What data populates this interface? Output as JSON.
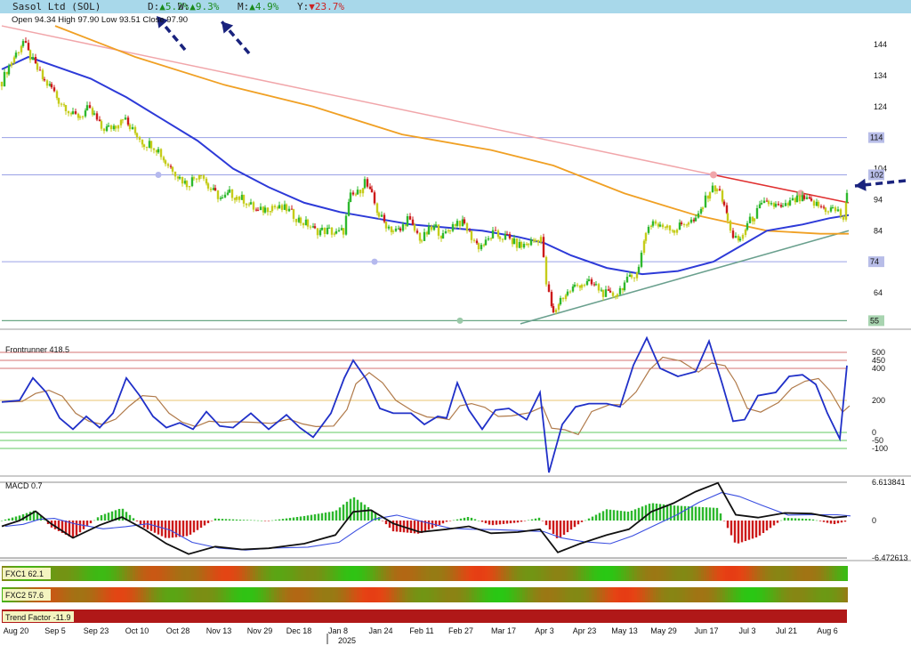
{
  "header": {
    "title": "Sasol Ltd (SOL)",
    "day": {
      "label": "D:",
      "arrow": "▲",
      "value": "5.2%",
      "color": "#1a8a1a"
    },
    "week": {
      "label": "W:",
      "arrow": "▲",
      "value": "9.3%",
      "color": "#1a8a1a"
    },
    "month": {
      "label": "M:",
      "arrow": "▲",
      "value": "4.9%",
      "color": "#1a8a1a"
    },
    "year": {
      "label": "Y:",
      "arrow": "▼",
      "value": "23.7%",
      "color": "#cc2222"
    }
  },
  "ohlc": "Open 94.34  High 97.90  Low 93.51  Close 97.90",
  "panels": {
    "frontrunner_label": "Frontrunner 418.5",
    "macd_label": "MACD 0.7",
    "fxc1_label": "FXC1 62.1",
    "fxc2_label": "FXC2 57.6",
    "trend_label": "Trend Factor -11.9"
  },
  "year_label": "2025",
  "chart_data": [
    {
      "type": "candlestick",
      "title": "Sasol Ltd (SOL)",
      "y_ticks": [
        144,
        134,
        124,
        104,
        94,
        84,
        64
      ],
      "ylim": [
        52,
        152
      ],
      "x_ticks": [
        "Aug 20",
        "Sep 5",
        "Sep 23",
        "Oct 10",
        "Oct 28",
        "Nov 13",
        "Nov 29",
        "Dec 18",
        "Jan 8",
        "Jan 24",
        "Feb 11",
        "Feb 27",
        "Mar 17",
        "Apr 3",
        "Apr 23",
        "May 13",
        "May 29",
        "Jun 17",
        "Jul 3",
        "Jul 21",
        "Aug 6"
      ],
      "price_tags": [
        {
          "value": "114",
          "price": 114,
          "bg": "#b8bde8"
        },
        {
          "value": "102",
          "price": 102,
          "bg": "#b8bde8"
        },
        {
          "value": "74",
          "price": 74,
          "bg": "#b8bde8"
        },
        {
          "value": "55",
          "price": 55,
          "bg": "#a8d4b0"
        }
      ],
      "close_path": [
        [
          0,
          132
        ],
        [
          8,
          137
        ],
        [
          16,
          141
        ],
        [
          24,
          145
        ],
        [
          32,
          140
        ],
        [
          40,
          136
        ],
        [
          48,
          132
        ],
        [
          56,
          130
        ],
        [
          64,
          126
        ],
        [
          72,
          124
        ],
        [
          80,
          121
        ],
        [
          88,
          121
        ],
        [
          96,
          123
        ],
        [
          104,
          121
        ],
        [
          112,
          117
        ],
        [
          120,
          117
        ],
        [
          128,
          118
        ],
        [
          136,
          121
        ],
        [
          144,
          117
        ],
        [
          152,
          115
        ],
        [
          160,
          112
        ],
        [
          168,
          112
        ],
        [
          176,
          110
        ],
        [
          184,
          106
        ],
        [
          192,
          104
        ],
        [
          200,
          101
        ],
        [
          208,
          99
        ],
        [
          216,
          101
        ],
        [
          224,
          103
        ],
        [
          232,
          98
        ],
        [
          240,
          96
        ],
        [
          248,
          94
        ],
        [
          256,
          96
        ],
        [
          264,
          95
        ],
        [
          272,
          94
        ],
        [
          280,
          92
        ],
        [
          288,
          90
        ],
        [
          296,
          91
        ],
        [
          304,
          92
        ],
        [
          312,
          91
        ],
        [
          320,
          91
        ],
        [
          328,
          89
        ],
        [
          336,
          87
        ],
        [
          344,
          86
        ],
        [
          352,
          84
        ],
        [
          360,
          84
        ],
        [
          368,
          84
        ],
        [
          376,
          83
        ],
        [
          384,
          84
        ],
        [
          392,
          95
        ],
        [
          400,
          96
        ],
        [
          408,
          100
        ],
        [
          416,
          95
        ],
        [
          424,
          89
        ],
        [
          432,
          86
        ],
        [
          440,
          84
        ],
        [
          448,
          84
        ],
        [
          456,
          88
        ],
        [
          464,
          84
        ],
        [
          472,
          81
        ],
        [
          480,
          84
        ],
        [
          488,
          85
        ],
        [
          496,
          82
        ],
        [
          504,
          85
        ],
        [
          512,
          87
        ],
        [
          520,
          86
        ],
        [
          528,
          82
        ],
        [
          536,
          79
        ],
        [
          544,
          80
        ],
        [
          552,
          83
        ],
        [
          560,
          82
        ],
        [
          568,
          82
        ],
        [
          576,
          80
        ],
        [
          584,
          79
        ],
        [
          592,
          80
        ],
        [
          600,
          81
        ],
        [
          606,
          82
        ],
        [
          612,
          67
        ],
        [
          620,
          57
        ],
        [
          628,
          62
        ],
        [
          636,
          64
        ],
        [
          644,
          66
        ],
        [
          652,
          67
        ],
        [
          660,
          67
        ],
        [
          668,
          66
        ],
        [
          676,
          64
        ],
        [
          684,
          63
        ],
        [
          692,
          64
        ],
        [
          700,
          67
        ],
        [
          708,
          69
        ],
        [
          716,
          72
        ],
        [
          724,
          84
        ],
        [
          732,
          87
        ],
        [
          740,
          85
        ],
        [
          748,
          86
        ],
        [
          756,
          84
        ],
        [
          764,
          86
        ],
        [
          772,
          87
        ],
        [
          780,
          87
        ],
        [
          788,
          92
        ],
        [
          796,
          97
        ],
        [
          804,
          98
        ],
        [
          812,
          92
        ],
        [
          816,
          88
        ],
        [
          822,
          81
        ],
        [
          830,
          81
        ],
        [
          838,
          86
        ],
        [
          846,
          89
        ],
        [
          854,
          92
        ],
        [
          862,
          93
        ],
        [
          870,
          92
        ],
        [
          878,
          91
        ],
        [
          886,
          93
        ],
        [
          894,
          94
        ],
        [
          902,
          94
        ],
        [
          910,
          93
        ],
        [
          918,
          92
        ],
        [
          926,
          91
        ],
        [
          934,
          91
        ],
        [
          940,
          90
        ],
        [
          946,
          88
        ],
        [
          950,
          95
        ]
      ],
      "ma_blue": [
        [
          0,
          136
        ],
        [
          30,
          140
        ],
        [
          60,
          137
        ],
        [
          100,
          133
        ],
        [
          140,
          127
        ],
        [
          180,
          120
        ],
        [
          220,
          113
        ],
        [
          260,
          104
        ],
        [
          300,
          98
        ],
        [
          340,
          93
        ],
        [
          380,
          90
        ],
        [
          420,
          88
        ],
        [
          460,
          86
        ],
        [
          500,
          85
        ],
        [
          540,
          84
        ],
        [
          580,
          82
        ],
        [
          610,
          80
        ],
        [
          640,
          76
        ],
        [
          680,
          72
        ],
        [
          720,
          70
        ],
        [
          760,
          71
        ],
        [
          800,
          74
        ],
        [
          830,
          79
        ],
        [
          860,
          84
        ],
        [
          900,
          86
        ],
        [
          930,
          88
        ],
        [
          952,
          89
        ]
      ],
      "ma_orange": [
        [
          60,
          150
        ],
        [
          150,
          140
        ],
        [
          250,
          131
        ],
        [
          350,
          124
        ],
        [
          450,
          115
        ],
        [
          550,
          110
        ],
        [
          620,
          105
        ],
        [
          700,
          96
        ],
        [
          780,
          89
        ],
        [
          860,
          84
        ],
        [
          920,
          83
        ],
        [
          952,
          83
        ]
      ],
      "trendline_pink": [
        [
          0,
          150
        ],
        [
          800,
          102
        ]
      ],
      "trendline_red": [
        [
          800,
          102
        ],
        [
          952,
          93
        ]
      ],
      "trendline_teal": [
        [
          583,
          54
        ],
        [
          952,
          84
        ]
      ],
      "level_lines": [
        114,
        102,
        74
      ]
    },
    {
      "type": "line",
      "title": "Frontrunner 418.5",
      "y_ticks": [
        "500",
        "450",
        "400",
        "200",
        "0",
        "-50",
        "-100"
      ],
      "ylim": [
        -160,
        560
      ]
    },
    {
      "type": "histogram+line",
      "title": "MACD 0.7",
      "y_ticks": [
        "6.613841",
        "0",
        "-6.472613"
      ],
      "ylim": [
        -6.472613,
        6.613841
      ]
    },
    {
      "type": "heatmap",
      "title": "FXC1 62.1"
    },
    {
      "type": "heatmap",
      "title": "FXC2 57.6"
    }
  ]
}
